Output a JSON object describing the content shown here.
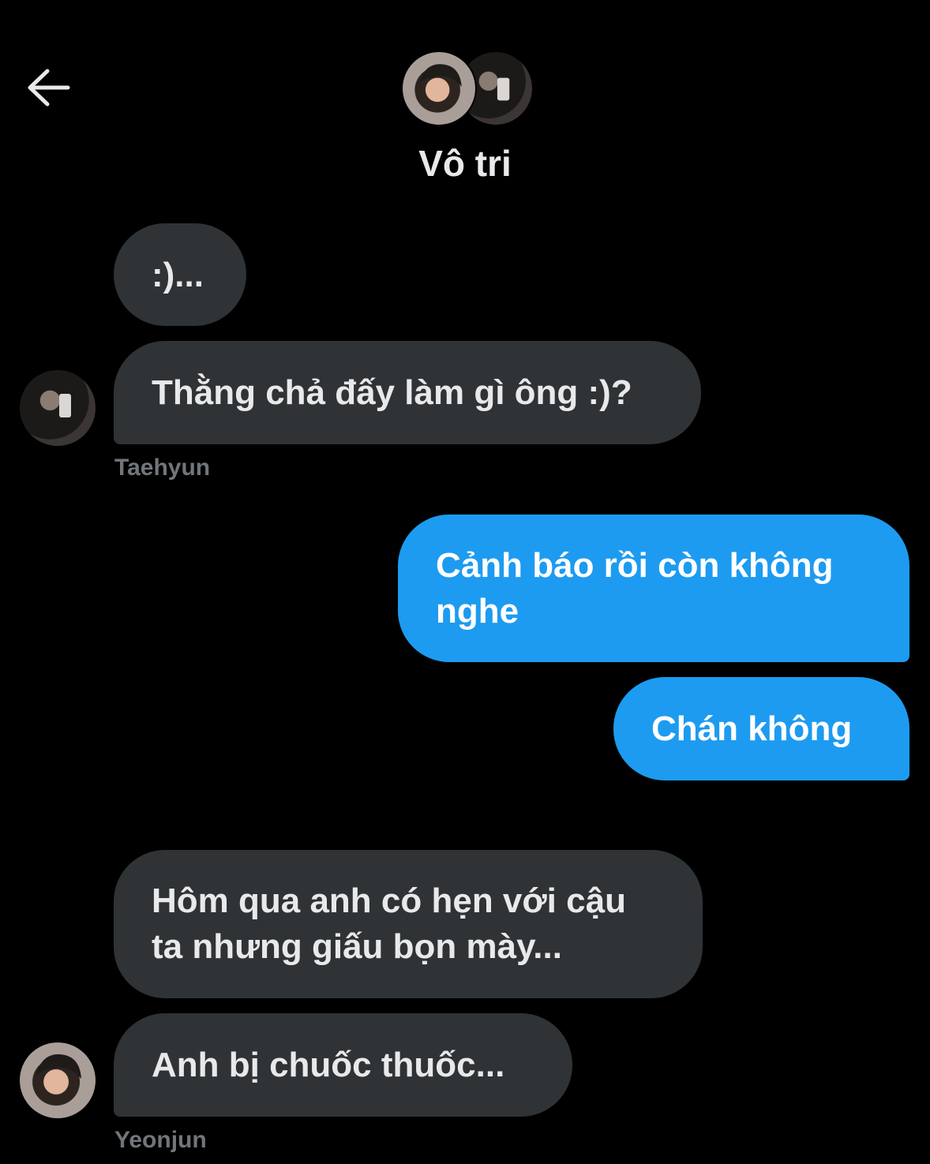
{
  "header": {
    "back_icon": "arrow-left-icon",
    "title": "Vô tri",
    "avatars": [
      "group-avatar-1",
      "group-avatar-2"
    ]
  },
  "messages": [
    {
      "direction": "incoming",
      "text": ":)..."
    },
    {
      "direction": "incoming",
      "text": "Thằng chả đấy làm gì ông :)?",
      "sender": "Taehyun"
    },
    {
      "direction": "outgoing",
      "lines": [
        "Cảnh báo rồi còn không",
        "nghe"
      ]
    },
    {
      "direction": "outgoing",
      "text": "Chán không"
    },
    {
      "direction": "incoming",
      "lines": [
        "Hôm qua anh có hẹn với cậu",
        "ta nhưng giấu bọn mày..."
      ]
    },
    {
      "direction": "incoming",
      "text": "Anh bị chuốc thuốc...",
      "sender": "Yeonjun"
    }
  ],
  "colors": {
    "background": "#000000",
    "incoming_bubble": "#2f3336",
    "outgoing_bubble": "#1d9bf0",
    "text_primary": "#e7e9ea",
    "text_secondary": "#71767b"
  }
}
